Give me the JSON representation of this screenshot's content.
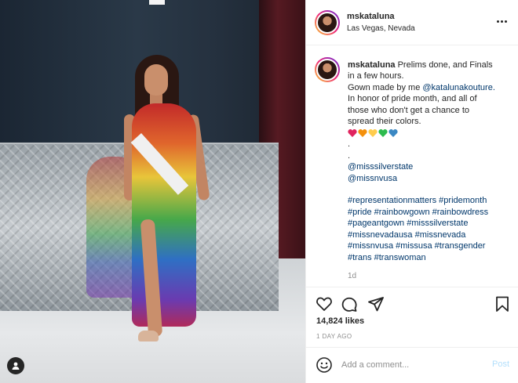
{
  "post": {
    "username": "mskataluna",
    "location": "Las Vegas, Nevada",
    "caption_lines": [
      "Prelims done, and Finals",
      "in a few hours.",
      "Gown made by me",
      "@katalunakouture.",
      "In honor of pride month, and all of",
      "those who don't get a chance to",
      "spread their colors.",
      ".",
      ".",
      "@misssilverstate",
      "@missnvusa",
      "#representationmatters #pridemonth",
      "#pride #rainbowgown #rainbowdress",
      "#pageantgown #misssilverstate",
      "#missnevadausa #missnevada",
      "#missnvusa #missusa #transgender",
      "#trans #transwoman"
    ],
    "heart_colors": [
      "#e0245e",
      "#f4900c",
      "#ffcc4d",
      "#2dbb4e",
      "#3b88c3"
    ],
    "comment_time": "1d",
    "likes": "14,824 likes",
    "date": "1 DAY AGO"
  },
  "comment_box": {
    "placeholder": "Add a comment...",
    "post_label": "Post"
  },
  "icons": {
    "more": "more-options-icon",
    "like": "heart-outline-icon",
    "comment": "comment-bubble-icon",
    "share": "paper-plane-icon",
    "save": "bookmark-icon",
    "emoji": "smiley-icon",
    "tag": "user-tag-icon"
  }
}
